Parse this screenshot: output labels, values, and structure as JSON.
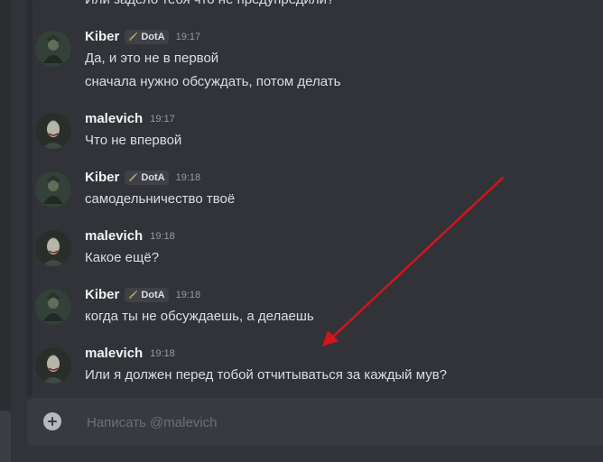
{
  "chat": {
    "truncated_line": "Или задело тебя что не предупредили?",
    "messages": [
      {
        "author": "Kiber",
        "role_tag": "DotA",
        "time": "19:17",
        "lines": [
          "Да, и это не в первой",
          "сначала нужно обсуждать, потом делать"
        ]
      },
      {
        "author": "malevich",
        "time": "19:17",
        "lines": [
          "Что не впервой"
        ]
      },
      {
        "author": "Kiber",
        "role_tag": "DotA",
        "time": "19:18",
        "lines": [
          "самодельничество твоё"
        ]
      },
      {
        "author": "malevich",
        "time": "19:18",
        "lines": [
          "Какое ещё?"
        ]
      },
      {
        "author": "Kiber",
        "role_tag": "DotA",
        "time": "19:18",
        "lines": [
          "когда ты не обсуждаешь, а делаешь"
        ]
      },
      {
        "author": "malevich",
        "time": "19:18",
        "lines": [
          "Или я должен перед тобой отчитываться за каждый мув?"
        ]
      }
    ]
  },
  "composer": {
    "placeholder": "Написать @malevich"
  },
  "icons": {
    "add": "plus-circle-icon",
    "role": "sword-icon"
  },
  "colors": {
    "background": "#313338",
    "composer": "#383a40",
    "annotation_arrow": "#d0161c"
  }
}
